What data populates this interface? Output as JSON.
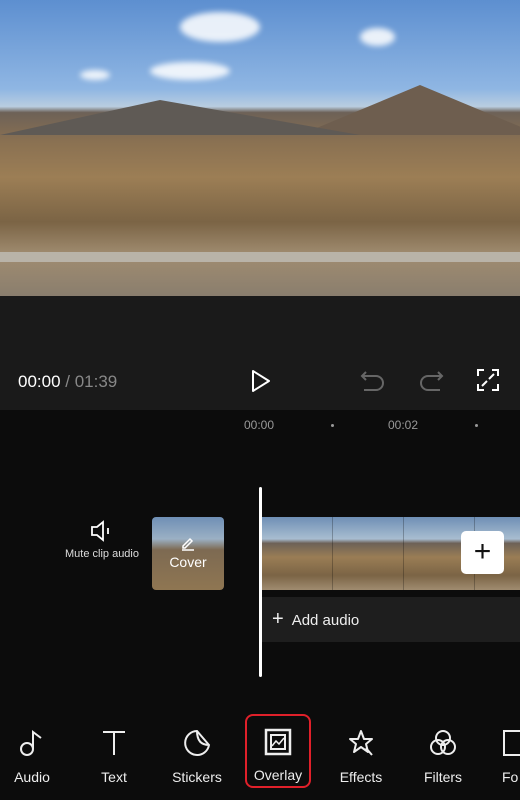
{
  "player": {
    "current_time": "00:00",
    "separator": " / ",
    "total_time": "01:39"
  },
  "timeline": {
    "ticks": [
      "00:00",
      "00:02"
    ],
    "mute_label": "Mute clip audio",
    "cover_label": "Cover",
    "add_audio_label": "Add audio"
  },
  "toolbar": {
    "items": [
      {
        "label": "Audio",
        "icon": "music-note-icon"
      },
      {
        "label": "Text",
        "icon": "text-icon"
      },
      {
        "label": "Stickers",
        "icon": "sticker-icon"
      },
      {
        "label": "Overlay",
        "icon": "overlay-icon",
        "selected": true
      },
      {
        "label": "Effects",
        "icon": "effects-star-icon"
      },
      {
        "label": "Filters",
        "icon": "filters-icon"
      },
      {
        "label": "Fo",
        "icon": "format-icon"
      }
    ]
  },
  "colors": {
    "selected_outline": "#e0202a",
    "background": "#0c0c0c",
    "control_bar": "#1a1a1a"
  }
}
